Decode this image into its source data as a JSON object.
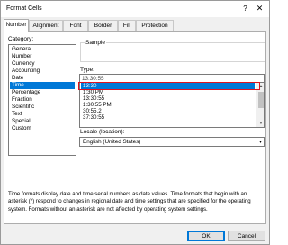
{
  "window": {
    "title": "Format Cells",
    "help": "?",
    "close": "✕"
  },
  "tabs": [
    "Number",
    "Alignment",
    "Font",
    "Border",
    "Fill",
    "Protection"
  ],
  "category": {
    "label": "Category:",
    "items": [
      "General",
      "Number",
      "Currency",
      "Accounting",
      "Date",
      "Time",
      "Percentage",
      "Fraction",
      "Scientific",
      "Text",
      "Special",
      "Custom"
    ],
    "selected": "Time"
  },
  "sample": {
    "label": "Sample"
  },
  "type": {
    "label": "Type:",
    "input_value": "13:30:55",
    "items": [
      "13:30",
      "1:30 PM",
      "13:30:55",
      "1:30:55 PM",
      "30:55.2",
      "37:30:55"
    ],
    "selected": "13:30"
  },
  "locale": {
    "label": "Locale (location):",
    "value": "English (United States)"
  },
  "description": "Time formats display date and time serial numbers as date values.  Time formats that begin with an asterisk (*) respond to changes in regional date and time settings that are specified for the operating system. Formats without an asterisk are not affected by operating system settings.",
  "buttons": {
    "ok": "OK",
    "cancel": "Cancel"
  },
  "colors": {
    "selection": "#0078d7",
    "highlight_outline": "#e0121f"
  }
}
